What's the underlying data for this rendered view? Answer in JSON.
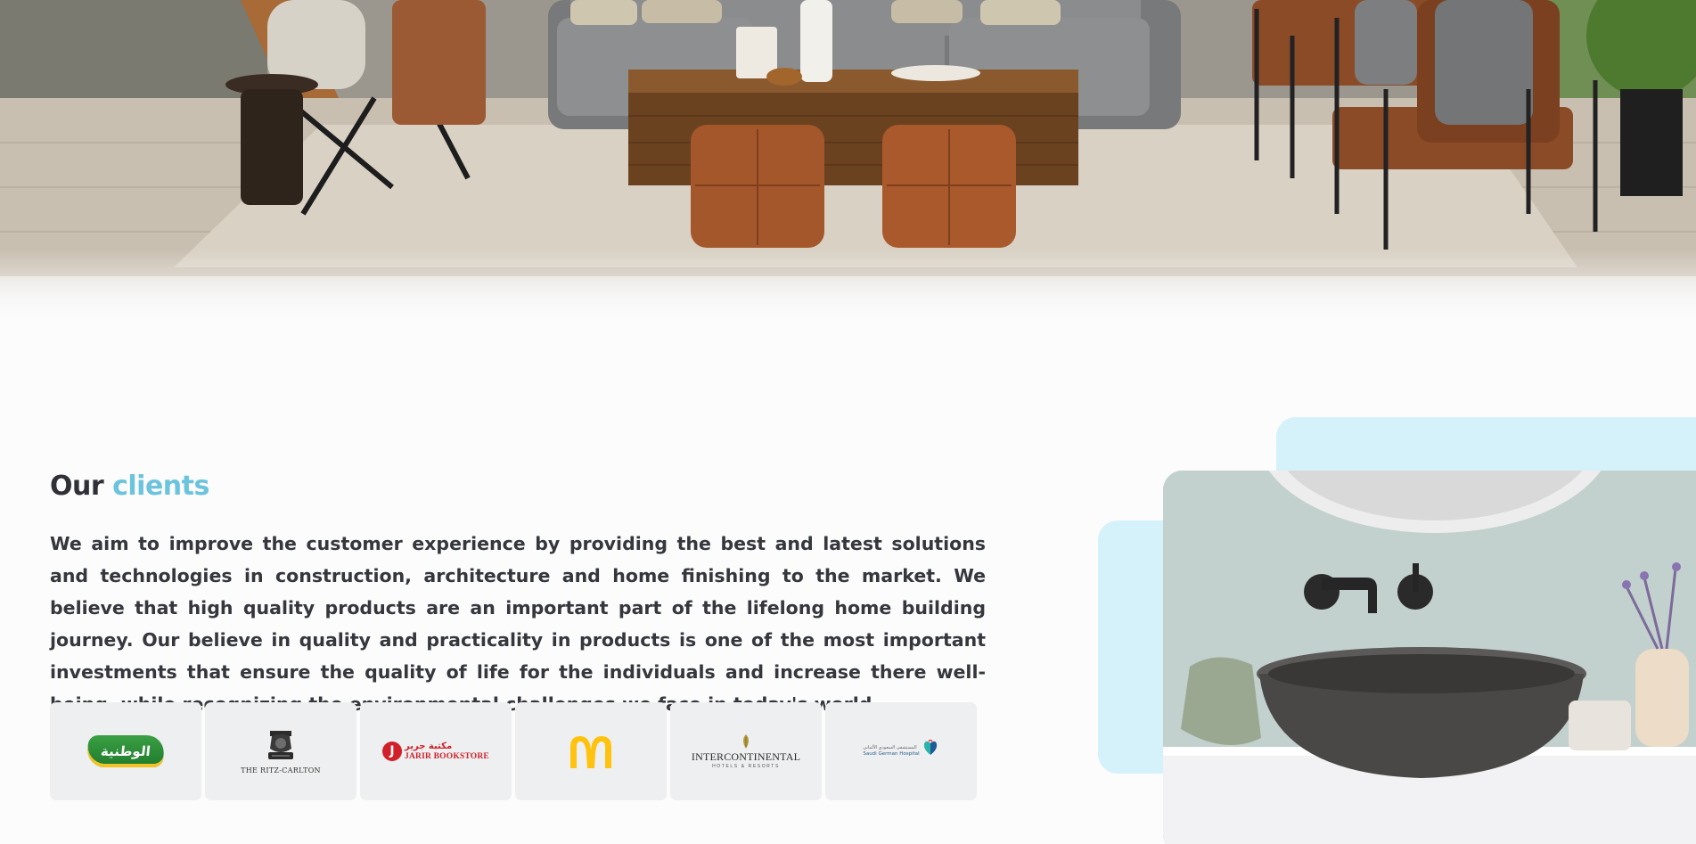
{
  "hero": {
    "image": "living-room-photo"
  },
  "clients": {
    "title_plain": "Our",
    "title_accent": "clients",
    "accent_color": "#6cc3dd",
    "description": "We aim to improve the customer experience by providing the best and latest solutions and technologies in construction, architecture and home finishing to the market. We believe that high quality products are an important part of the lifelong home building journey. Our believe in quality and practicality in products is one of the most important investments that ensure the quality of life for the individuals and increase there well-being, while recognizing the environmental challenges we face in today's world.",
    "logos": [
      {
        "name": "alwatania-logo",
        "text": "الوطنية"
      },
      {
        "name": "ritz-carlton-logo",
        "text": "THE RITZ-CARLTON"
      },
      {
        "name": "jarir-bookstore-logo",
        "text_ar": "مكتبة جرير",
        "text_en": "JARIR BOOKSTORE",
        "mark": "J"
      },
      {
        "name": "mcdonalds-logo",
        "color": "#ffc20e"
      },
      {
        "name": "intercontinental-logo",
        "text": "INTERCONTINENTAL",
        "subtext": "HOTELS & RESORTS"
      },
      {
        "name": "saudi-german-hospital-logo",
        "text_ar": "المستشفى السعودي الألماني",
        "text_en": "Saudi German Hospital"
      }
    ]
  },
  "side_image": {
    "image": "bathroom-sink-photo",
    "decor_color": "#d5f2fa"
  }
}
